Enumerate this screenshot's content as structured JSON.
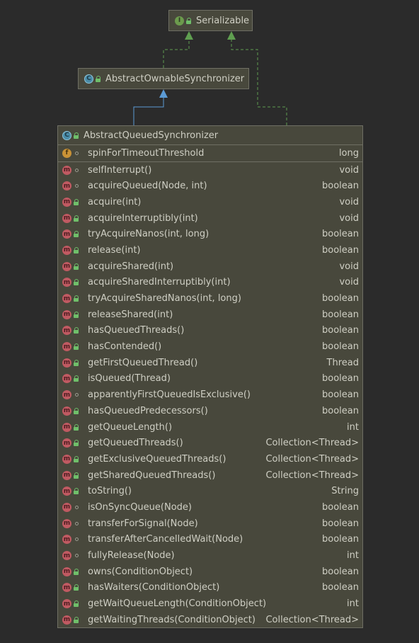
{
  "classes": {
    "serializable": {
      "kind": "interface",
      "name": "Serializable"
    },
    "aos": {
      "kind": "abstract class",
      "name": "AbstractOwnableSynchronizer"
    },
    "aqs": {
      "kind": "abstract class",
      "name": "AbstractQueuedSynchronizer"
    }
  },
  "fields": [
    {
      "name": "spinForTimeoutThreshold",
      "type": "long",
      "icon": "field-icon",
      "visibility": "package"
    }
  ],
  "methods": [
    {
      "name": "selfInterrupt()",
      "type": "void",
      "visibility": "package"
    },
    {
      "name": "acquireQueued(Node, int)",
      "type": "boolean",
      "visibility": "package"
    },
    {
      "name": "acquire(int)",
      "type": "void",
      "visibility": "public"
    },
    {
      "name": "acquireInterruptibly(int)",
      "type": "void",
      "visibility": "public"
    },
    {
      "name": "tryAcquireNanos(int, long)",
      "type": "boolean",
      "visibility": "public"
    },
    {
      "name": "release(int)",
      "type": "boolean",
      "visibility": "public"
    },
    {
      "name": "acquireShared(int)",
      "type": "void",
      "visibility": "public"
    },
    {
      "name": "acquireSharedInterruptibly(int)",
      "type": "void",
      "visibility": "public"
    },
    {
      "name": "tryAcquireSharedNanos(int, long)",
      "type": "boolean",
      "visibility": "public"
    },
    {
      "name": "releaseShared(int)",
      "type": "boolean",
      "visibility": "public"
    },
    {
      "name": "hasQueuedThreads()",
      "type": "boolean",
      "visibility": "public"
    },
    {
      "name": "hasContended()",
      "type": "boolean",
      "visibility": "public"
    },
    {
      "name": "getFirstQueuedThread()",
      "type": "Thread",
      "visibility": "public"
    },
    {
      "name": "isQueued(Thread)",
      "type": "boolean",
      "visibility": "public"
    },
    {
      "name": "apparentlyFirstQueuedIsExclusive()",
      "type": "boolean",
      "visibility": "package"
    },
    {
      "name": "hasQueuedPredecessors()",
      "type": "boolean",
      "visibility": "public"
    },
    {
      "name": "getQueueLength()",
      "type": "int",
      "visibility": "public"
    },
    {
      "name": "getQueuedThreads()",
      "type": "Collection<Thread>",
      "visibility": "public"
    },
    {
      "name": "getExclusiveQueuedThreads()",
      "type": "Collection<Thread>",
      "visibility": "public"
    },
    {
      "name": "getSharedQueuedThreads()",
      "type": "Collection<Thread>",
      "visibility": "public"
    },
    {
      "name": "toString()",
      "type": "String",
      "visibility": "public"
    },
    {
      "name": "isOnSyncQueue(Node)",
      "type": "boolean",
      "visibility": "package"
    },
    {
      "name": "transferForSignal(Node)",
      "type": "boolean",
      "visibility": "package"
    },
    {
      "name": "transferAfterCancelledWait(Node)",
      "type": "boolean",
      "visibility": "package"
    },
    {
      "name": "fullyRelease(Node)",
      "type": "int",
      "visibility": "package"
    },
    {
      "name": "owns(ConditionObject)",
      "type": "boolean",
      "visibility": "public"
    },
    {
      "name": "hasWaiters(ConditionObject)",
      "type": "boolean",
      "visibility": "public"
    },
    {
      "name": "getWaitQueueLength(ConditionObject)",
      "type": "int",
      "visibility": "public"
    },
    {
      "name": "getWaitingThreads(ConditionObject)",
      "type": "Collection<Thread>",
      "visibility": "public"
    }
  ],
  "colors": {
    "background": "#2b2b2b",
    "box_fill": "#48483c",
    "box_border": "#6f6f64",
    "text": "#cfcfc4",
    "extends_edge": "#5b9bd5",
    "implements_edge": "#5f9e50"
  },
  "relations": [
    {
      "from": "AbstractOwnableSynchronizer",
      "to": "Serializable",
      "kind": "implements",
      "style": "dashed"
    },
    {
      "from": "AbstractQueuedSynchronizer",
      "to": "Serializable",
      "kind": "implements",
      "style": "dashed"
    },
    {
      "from": "AbstractQueuedSynchronizer",
      "to": "AbstractOwnableSynchronizer",
      "kind": "extends",
      "style": "solid"
    }
  ]
}
